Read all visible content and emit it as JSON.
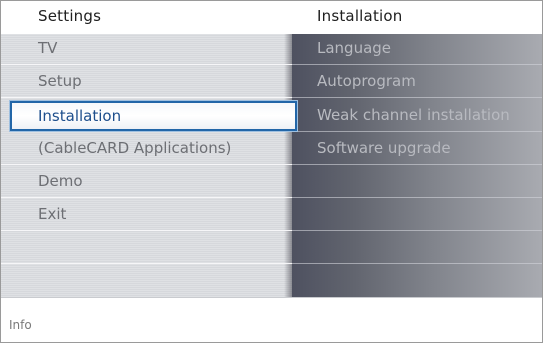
{
  "header": {
    "left_title": "Settings",
    "right_title": "Installation"
  },
  "menu": {
    "items": [
      {
        "label": "TV"
      },
      {
        "label": "Setup"
      },
      {
        "label": "Installation",
        "selected": true
      },
      {
        "label": "(CableCARD Applications)"
      },
      {
        "label": "Demo"
      },
      {
        "label": "Exit"
      },
      {
        "label": ""
      },
      {
        "label": ""
      }
    ]
  },
  "submenu": {
    "items": [
      {
        "label": "Language"
      },
      {
        "label": "Autoprogram"
      },
      {
        "label": "Weak channel installation"
      },
      {
        "label": "Software upgrade"
      },
      {
        "label": ""
      },
      {
        "label": ""
      },
      {
        "label": ""
      },
      {
        "label": ""
      }
    ]
  },
  "footer": {
    "info_label": "Info"
  },
  "colors": {
    "selection_border": "#2266a8",
    "selected_text": "#1d4e8c"
  }
}
